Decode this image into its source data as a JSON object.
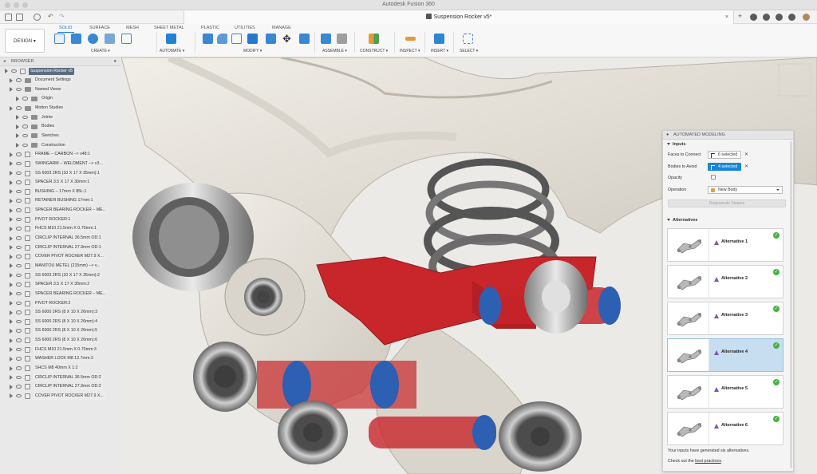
{
  "app": {
    "title": "Autodesk Fusion 360"
  },
  "document": {
    "tab_title": "Suspension Rocker v5*"
  },
  "workspace": {
    "design_label": "DESIGN"
  },
  "toolbar": {
    "tabs": [
      "SOLID",
      "SURFACE",
      "MESH",
      "SHEET METAL",
      "PLASTIC",
      "UTILITIES",
      "MANAGE"
    ],
    "active_tab": "SOLID",
    "groups": [
      "CREATE",
      "AUTOMATE",
      "MODIFY",
      "ASSEMBLE",
      "CONSTRUCT",
      "INSPECT",
      "INSERT",
      "SELECT"
    ]
  },
  "browser": {
    "title": "BROWSER",
    "root": "Suspension Rocker v5",
    "items": [
      "Document Settings",
      "Named Views",
      "Origin",
      "Motion Studies",
      "Joints",
      "Bodies",
      "Sketches",
      "Construction",
      "FRAME – CARBON –> v48:1",
      "SWINGARM – WELDMENT –> v3...",
      "SS 6003 2RS (10 X 17 X 35mm):1",
      "SPACER 3.5 X 17 X 30mm:1",
      "BUSHING – 17mm X 85L:1",
      "RETAINER BUSHING 17mm:1",
      "SPACER BEARING ROCKER – ME...",
      "PIVOT ROCKER:1",
      "FHCS M10 21.5mm X 0.70mm:1",
      "CIRCLIP INTERNAL 36.5mm OD:1",
      "CIRCLIP INTERNAL 27.9mm OD:1",
      "COVER PIVOT ROCKER M27.9 X...",
      "MANITOU METEL (215mm) –> v...",
      "SS 6003 2RS (10 X 17 X 35mm):2",
      "SPACER 3.5 X 17 X 30mm:2",
      "SPACER BEARING ROCKER – ME...",
      "PIVOT ROCKER:2",
      "SS 6000 2RS (8 X 10 X 26mm):3",
      "SS 6000 2RS (8 X 10 X 26mm):4",
      "SS 6000 2RS (8 X 10 X 26mm):5",
      "SS 6000 2RS (8 X 10 X 26mm):6",
      "FHCS M10 21.5mm X 0.70mm:3",
      "WASHER LOCK M8 12.7mm:3",
      "SHCS M8 40mm X 1:2",
      "CIRCLIP INTERNAL 36.5mm OD:2",
      "CIRCLIP INTERNAL 27.9mm OD:2",
      "COVER PIVOT ROCKER M27.9 X..."
    ]
  },
  "automated_modeling": {
    "title": "AUTOMATED MODELING",
    "inputs_header": "Inputs",
    "faces_label": "Faces to Connect",
    "faces_value": "6 selected",
    "bodies_label": "Bodies to Avoid",
    "bodies_value": "4 selected",
    "opacity_label": "Opacity",
    "operation_label": "Operation",
    "operation_value": "New Body",
    "regenerate_label": "Regenerate Shapes",
    "alternatives_header": "Alternatives",
    "alternatives": [
      "Alternative 1",
      "Alternative 2",
      "Alternative 3",
      "Alternative 4",
      "Alternative 5",
      "Alternative 6"
    ],
    "selected_alternative": 4,
    "footer_text": "Your inputs have generated six alternatives.",
    "footer_prefix": "Check out the",
    "footer_link": "best practices",
    "footer_suffix": "."
  },
  "colors": {
    "accent": "#1a86d9",
    "selection": "#c6def0",
    "part_red": "#c8262a",
    "part_blue": "#2d5fb3",
    "success": "#47b240"
  }
}
